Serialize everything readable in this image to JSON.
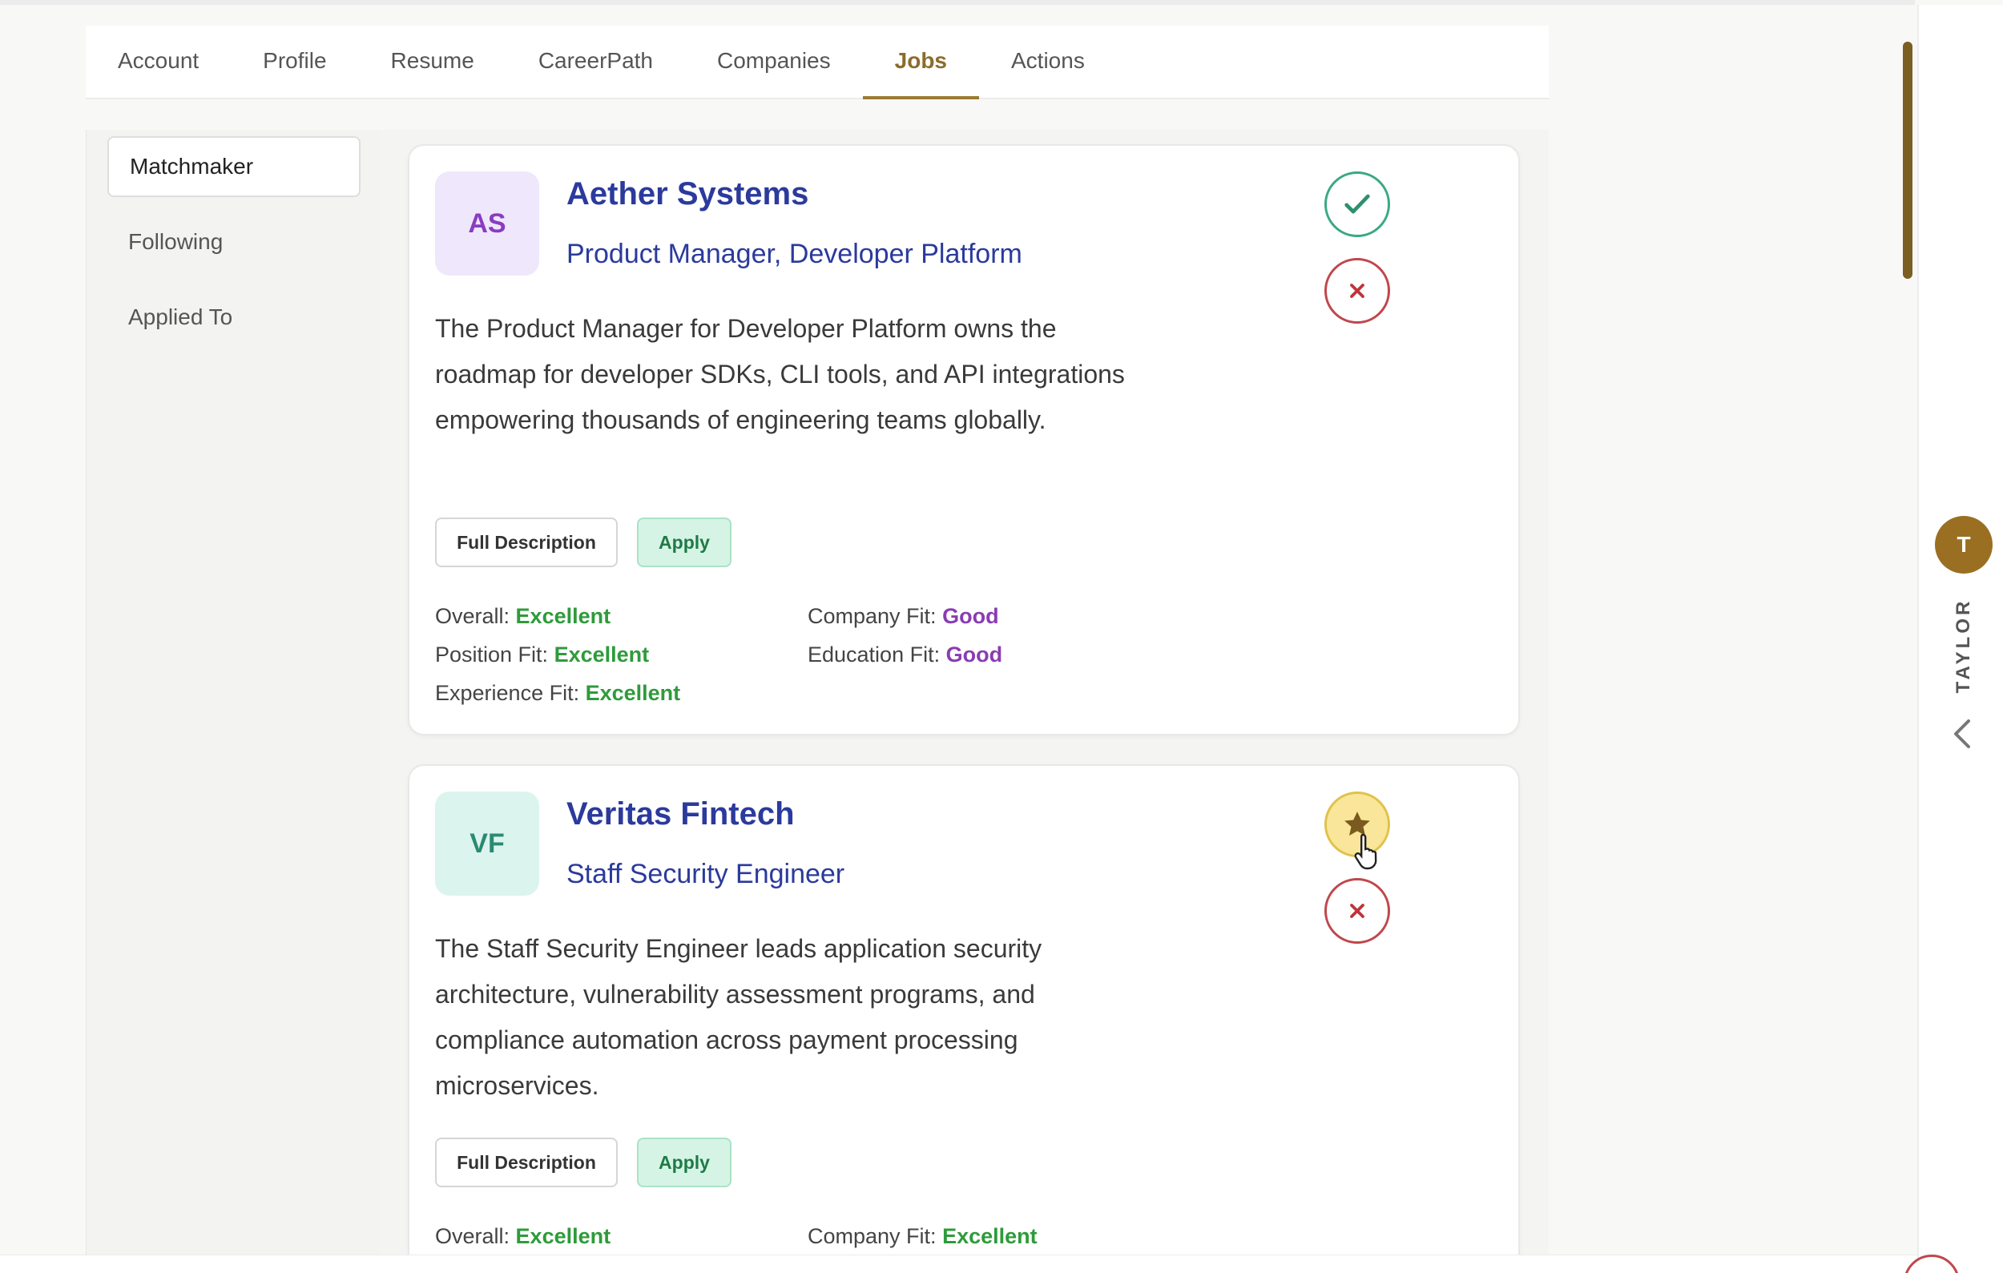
{
  "tabs": [
    "Account",
    "Profile",
    "Resume",
    "CareerPath",
    "Companies",
    "Jobs",
    "Actions"
  ],
  "active_tab": "Jobs",
  "sidebar": {
    "items": [
      "Matchmaker",
      "Following",
      "Applied To"
    ],
    "active": "Matchmaker"
  },
  "jobs": [
    {
      "logo_initials": "AS",
      "company": "Aether Systems",
      "role": "Product Manager, Developer Platform",
      "description": "The Product Manager for Developer Platform owns the roadmap for developer SDKs, CLI tools, and API integrations empowering thousands of engineering teams globally.",
      "buttons": {
        "full_description": "Full Description",
        "apply": "Apply"
      },
      "metrics": {
        "overall": {
          "label": "Overall:",
          "value": "Excellent"
        },
        "company_fit": {
          "label": "Company Fit:",
          "value": "Good"
        },
        "position_fit": {
          "label": "Position Fit:",
          "value": "Excellent"
        },
        "education_fit": {
          "label": "Education Fit:",
          "value": "Good"
        },
        "experience_fit": {
          "label": "Experience Fit:",
          "value": "Excellent"
        }
      },
      "actions": [
        "check-icon",
        "close-icon"
      ]
    },
    {
      "logo_initials": "VF",
      "company": "Veritas Fintech",
      "role": "Staff Security Engineer",
      "description": "The Staff Security Engineer leads application security architecture, vulnerability assessment programs, and compliance automation across payment processing microservices.",
      "buttons": {
        "full_description": "Full Description",
        "apply": "Apply"
      },
      "metrics": {
        "overall": {
          "label": "Overall:",
          "value": "Excellent"
        },
        "company_fit": {
          "label": "Company Fit:",
          "value": "Excellent"
        }
      },
      "actions": [
        "star-icon",
        "close-icon"
      ]
    }
  ],
  "user": {
    "initial": "T",
    "name": "TAYLOR"
  },
  "colors": {
    "accent": "#9a7b35",
    "heading": "#2b3a9c",
    "excellent": "#2e9b3a",
    "good": "#8a3cb3",
    "avatar": "#9a6f22"
  }
}
